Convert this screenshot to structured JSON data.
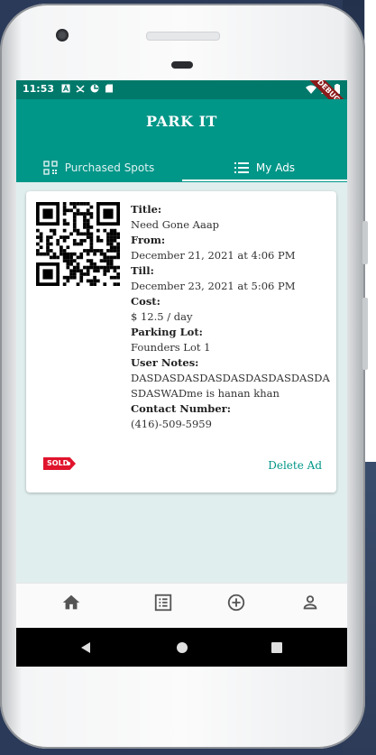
{
  "status_bar": {
    "time": "11:53",
    "debug_label": "DEBUG"
  },
  "app_bar": {
    "title": "PARK IT"
  },
  "tabs": [
    {
      "label": "Purchased Spots",
      "icon": "qr-code-icon",
      "selected": false
    },
    {
      "label": "My Ads",
      "icon": "list-icon",
      "selected": true
    }
  ],
  "ad": {
    "title_label": "Title:",
    "title_value": "Need Gone Aaap",
    "from_label": "From:",
    "from_value": "December 21, 2021 at  4:06 PM",
    "till_label": "Till:",
    "till_value": "December 23, 2021 at  5:06 PM",
    "cost_label": "Cost:",
    "cost_value": "$ 12.5 / day",
    "lot_label": "Parking Lot:",
    "lot_value": "Founders Lot 1",
    "notes_label": "User Notes:",
    "notes_value": "DASDASDASDASDASDASDASDASDASDASWADme is hanan khan",
    "contact_label": "Contact Number:",
    "contact_value": "(416)-509-5959",
    "sold_badge": "SOLD",
    "delete_label": "Delete Ad"
  },
  "bottom_nav": [
    "home-icon",
    "list-alt-icon",
    "add-circle-icon",
    "person-icon"
  ],
  "colors": {
    "primary": "#009688",
    "primary_dark": "#00796b",
    "background": "#e0eeee",
    "sold": "#e0142c"
  }
}
